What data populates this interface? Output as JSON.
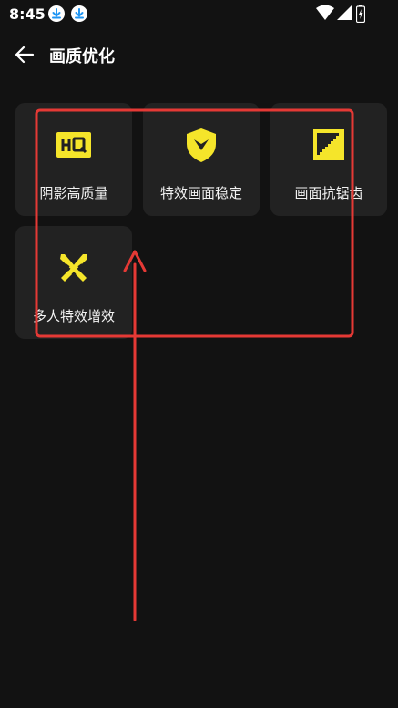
{
  "status_bar": {
    "time": "8:45",
    "icons": [
      "download-icon",
      "download-icon",
      "wifi-icon",
      "signal-icon",
      "battery-charging-icon"
    ]
  },
  "header": {
    "back_icon": "arrow-left-icon",
    "title": "画质优化"
  },
  "options": [
    {
      "label": "阴影高质量",
      "icon": "hq-icon"
    },
    {
      "label": "特效画面稳定",
      "icon": "shield-icon"
    },
    {
      "label": "画面抗锯齿",
      "icon": "stair-square-icon"
    },
    {
      "label": "多人特效增效",
      "icon": "crossed-swords-icon"
    }
  ],
  "colors": {
    "background": "#121212",
    "tile": "#222222",
    "icon_accent": "#f5e52a",
    "annotation": "#e53935",
    "status_icon_blue": "#2196f3"
  }
}
